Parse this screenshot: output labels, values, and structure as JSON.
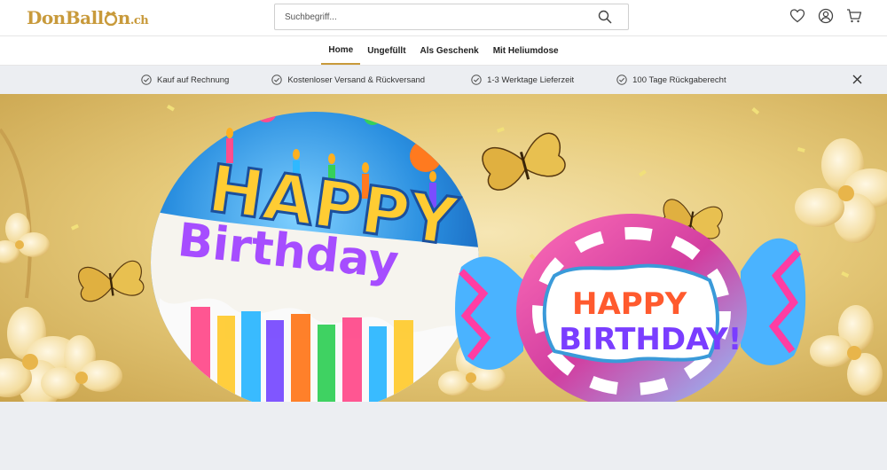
{
  "brand": {
    "logo_text": "DonBall",
    "logo_text_after": "n",
    "logo_tld": ".ch",
    "accent": "#c89a3b"
  },
  "search": {
    "placeholder": "Suchbegriff..."
  },
  "header_icons": [
    "heart-icon",
    "user-icon",
    "cart-icon"
  ],
  "nav": {
    "items": [
      "Home",
      "Ungefüllt",
      "Als Geschenk",
      "Mit Heliumdose"
    ],
    "active": "Home"
  },
  "usp": {
    "items": [
      "Kauf auf Rechnung",
      "Kostenloser Versand & Rückversand",
      "1-3 Werktage Lieferzeit",
      "100 Tage Rückgaberecht"
    ]
  },
  "hero": {
    "balloon_left": {
      "line1": "HAPPY",
      "line2": "Birthday"
    },
    "balloon_right": {
      "line1": "HAPPY",
      "line2": "BIRTHDAY!"
    }
  }
}
